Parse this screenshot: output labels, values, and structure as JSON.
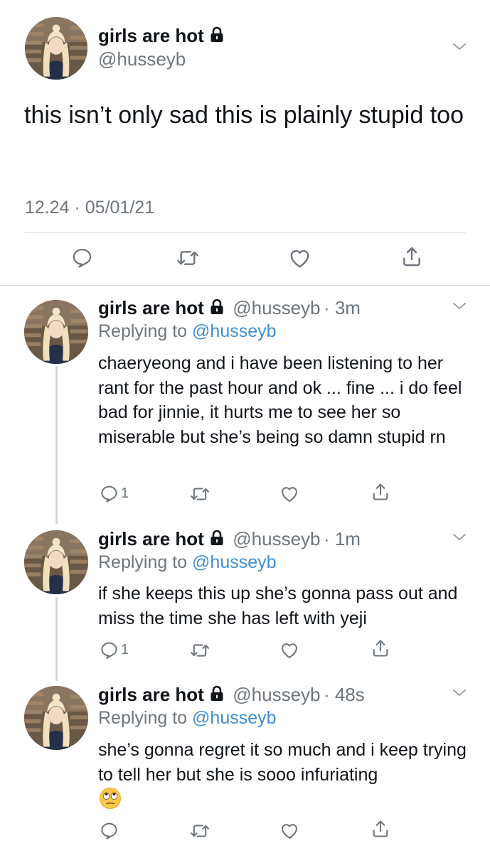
{
  "main_tweet": {
    "display_name": "girls are hot",
    "handle": "@husseyb",
    "text": "this isn’t only sad this is plainly stupid too",
    "timestamp": "12.24 · 05/01/21",
    "icons": [
      "lock-icon",
      "chevron-down-icon",
      "reply-icon",
      "retweet-icon",
      "like-icon",
      "share-icon"
    ]
  },
  "replies": [
    {
      "display_name": "girls are hot",
      "handle": "@husseyb",
      "age": "· 3m",
      "replying_prefix": "Replying to",
      "replying_to": "@husseyb",
      "text": "chaeryeong and i have been listening to her rant for the past hour and ok ... fine ... i do feel bad for jinnie, it hurts me to see her so miserable but she’s being so damn stupid rn",
      "reply_count": "1"
    },
    {
      "display_name": "girls are hot",
      "handle": "@husseyb",
      "age": "· 1m",
      "replying_prefix": "Replying to",
      "replying_to": "@husseyb",
      "text": "if she keeps this up she’s gonna pass out and miss the time she has left with yeji",
      "reply_count": "1"
    },
    {
      "display_name": "girls are hot",
      "handle": "@husseyb",
      "age": "· 48s",
      "replying_prefix": "Replying to",
      "replying_to": "@husseyb",
      "text": "she’s gonna regret it so much and i keep trying to tell her but she is sooo infuriating",
      "emoji": "face-with-rolling-eyes",
      "reply_count": ""
    }
  ],
  "colors": {
    "text": "#0f1419",
    "muted": "#6e767d",
    "link": "#3f8fd2",
    "divider": "#dcdfe2",
    "thread_line": "#cfd9de"
  }
}
